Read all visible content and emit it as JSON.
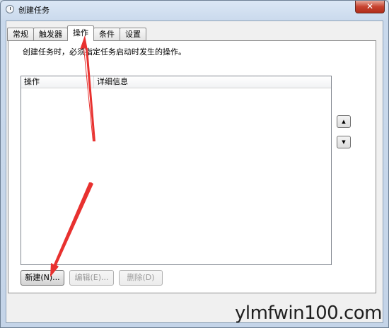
{
  "window": {
    "title": "创建任务",
    "close_label": "✕"
  },
  "tabs": [
    {
      "label": "常规"
    },
    {
      "label": "触发器"
    },
    {
      "label": "操作"
    },
    {
      "label": "条件"
    },
    {
      "label": "设置"
    }
  ],
  "panel": {
    "description": "创建任务时，必须指定任务启动时发生的操作。"
  },
  "list": {
    "columns": [
      "操作",
      "详细信息"
    ]
  },
  "order_buttons": {
    "up": "▲",
    "down": "▼"
  },
  "buttons": {
    "new": "新建(N)...",
    "edit": "编辑(E)...",
    "delete": "删除(D)"
  },
  "watermark": "ylmfwin100.com",
  "colors": {
    "annotation_arrow": "#e8312f"
  }
}
